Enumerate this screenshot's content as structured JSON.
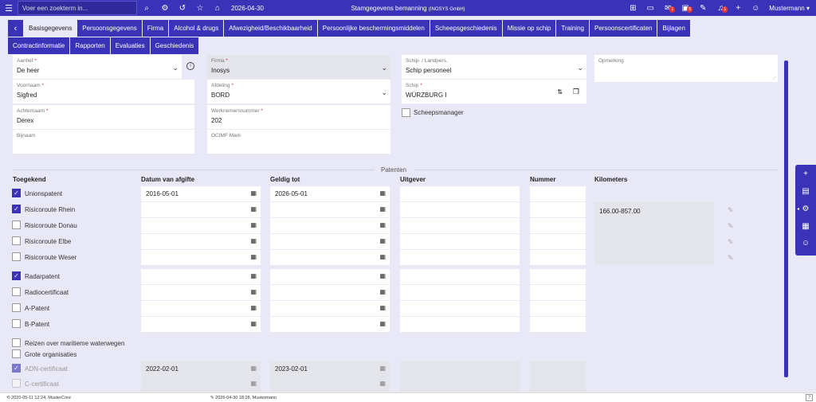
{
  "header": {
    "search_placeholder": "Voer een zoekterm in...",
    "date": "2026-04-30",
    "title": "Stamgegevens bemanning",
    "title_company": "(INOSYS GmbH)",
    "badges": {
      "mail": "1",
      "alert": "5",
      "notif": "1"
    },
    "user": "Mustermann"
  },
  "tabs_row1": [
    "Basisgegevens",
    "Persoonsgegevens",
    "Firma",
    "Alcohol & drugs",
    "Afwezigheid/Beschikbaarheid",
    "Persoonlijke beschermingsmiddelen",
    "Scheepsgeschiedenis",
    "Missie op schip",
    "Training",
    "Persoonscertificaten",
    "Bijlagen"
  ],
  "tabs_row2": [
    "Contractinformatie",
    "Rapporten",
    "Evaluaties",
    "Geschiedenis"
  ],
  "form": {
    "aanhef": {
      "label": "Aanhef",
      "value": "De heer"
    },
    "voornaam": {
      "label": "Voornaam",
      "value": "Sigfred"
    },
    "achternaam": {
      "label": "Achternaam",
      "value": "Derex"
    },
    "bijnaam": {
      "label": "Bijnaam",
      "value": ""
    },
    "firma": {
      "label": "Firma",
      "value": "Inosys"
    },
    "afdeling": {
      "label": "Afdeling",
      "value": "BORD"
    },
    "werknemersnummer": {
      "label": "Werknemersnummer",
      "value": "202"
    },
    "ocimf": {
      "label": "OCIMF Mark",
      "value": ""
    },
    "schip_landpers": {
      "label": "Schip- / Landpers.",
      "value": "Schip personeel"
    },
    "schip": {
      "label": "Schip",
      "value": "WÜRZBURG I"
    },
    "scheepsmanager": "Scheepsmanager",
    "opmerking": {
      "label": "Opmerking",
      "value": ""
    },
    "required_mark": "*"
  },
  "patenten": {
    "section_title": "Patenten",
    "columns": {
      "toegekend": "Toegekend",
      "afgifte": "Datum van afgifte",
      "geldig": "Geldig tot",
      "uitgever": "Uitgever",
      "nummer": "Nummer",
      "km": "Kilometers"
    },
    "rows": [
      {
        "label": "Unionspatent",
        "checked": true,
        "afgifte": "2016-05-01",
        "geldig": "2026-05-01"
      },
      {
        "label": "Risicoroute Rhein",
        "checked": true,
        "afgifte": "",
        "geldig": ""
      },
      {
        "label": "Risicoroute Donau",
        "checked": false,
        "afgifte": "",
        "geldig": ""
      },
      {
        "label": "Risicoroute Elbe",
        "checked": false,
        "afgifte": "",
        "geldig": ""
      },
      {
        "label": "Risicoroute Weser",
        "checked": false,
        "afgifte": "",
        "geldig": ""
      },
      {
        "label": "Radarpatent",
        "checked": true,
        "afgifte": "",
        "geldig": ""
      },
      {
        "label": "Radiocertificaat",
        "checked": false,
        "afgifte": "",
        "geldig": ""
      },
      {
        "label": "A-Patent",
        "checked": false,
        "afgifte": "",
        "geldig": ""
      },
      {
        "label": "B-Patent",
        "checked": false,
        "afgifte": "",
        "geldig": ""
      },
      {
        "label": "Reizen over maritieme waterwegen",
        "checked": false
      },
      {
        "label": "Grote organisaties",
        "checked": false
      },
      {
        "label": "ADN-certificaat",
        "checked": true,
        "afgifte": "2022-02-01",
        "geldig": "2023-02-01"
      },
      {
        "label": "C-certificaat",
        "checked": false,
        "afgifte": "",
        "geldig": ""
      }
    ],
    "kilometers": "166.00-857.00"
  },
  "footer": {
    "created": "2020-05-11 12:24, MusterCore",
    "modified": "2026-04-30 18:28, Mustermann"
  }
}
